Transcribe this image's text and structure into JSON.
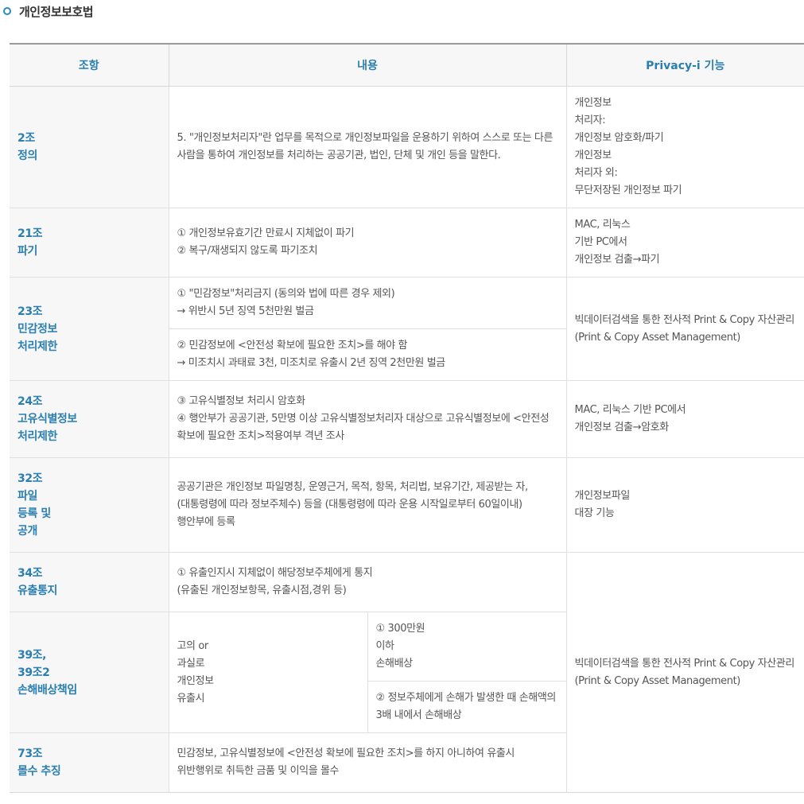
{
  "heading": "개인정보보호법",
  "columns": [
    "조항",
    "내용",
    "Privacy-i 기능"
  ],
  "rows": {
    "r1": {
      "article": "2조\n정의",
      "content": "5. \"개인정보처리자\"란 업무를 목적으로 개인정보파일을 운용하기 위하여 스스로 또는 다른 사람을 통하여 개인정보를 처리하는 공공기관, 법인, 단체 및 개인 등을 말한다.",
      "feature": "개인정보\n처리자:\n개인정보 암호화/파기\n개인정보\n처리자 외:\n무단저장된 개인정보 파기"
    },
    "r2": {
      "article": "21조\n파기",
      "content": "① 개인정보유효기간 만료시 지체없이 파기\n② 복구/재생되지 않도록 파기조치",
      "feature": "MAC, 리눅스\n기반 PC에서\n개인정보 검출→파기"
    },
    "r3": {
      "article": "23조\n민감정보\n처리제한",
      "content_a": "① \"민감정보\"처리금지 (동의와 법에 따른 경우 제외)\n→ 위반시 5년 징역 5천만원 벌금",
      "content_b": "② 민감정보에 <안전성 확보에 필요한 조치>를 해야 함\n→ 미조치시 과태료 3천, 미조치로 유출시 2년 징역 2천만원 벌금",
      "feature": "빅데이터검색을 통한 전사적 Print & Copy 자산관리\n(Print & Copy Asset Management)"
    },
    "r4": {
      "article": "24조\n고유식별정보\n처리제한",
      "content": "③ 고유식별정보 처리시 암호화\n④ 행안부가 공공기관, 5만명 이상 고유식별정보처리자 대상으로 고유식별정보에 <안전성 확보에 필요한 조치>적용여부 격년 조사",
      "feature": "MAC, 리눅스 기반 PC에서\n개인정보 검출→암호화"
    },
    "r5": {
      "article": "32조\n파일\n등록 및\n공개",
      "content": "공공기관은 개인정보 파일명칭, 운영근거, 목적, 항목, 처리법, 보유기간, 제공받는 자, (대통령령에 따라 정보주체수) 등을 (대통령령에 따라 운용 시작일로부터 60일이내) 행안부에 등록",
      "feature": "개인정보파일\n대장 기능"
    },
    "r6": {
      "article": "34조\n유출통지",
      "content": "① 유출인지시 지체없이 해당정보주체에게 통지\n(유출된 개인정보항목, 유출시점,경위 등)"
    },
    "r7": {
      "article": "39조,\n39조2\n손해배상책임",
      "content_left": "고의 or\n과실로\n개인정보\n유출시",
      "content_a": "① 300만원\n이하\n손해배상",
      "content_b": "② 정보주체에게 손해가 발생한 때 손해액의 3배 내에서 손해배상"
    },
    "r8": {
      "article": "73조\n몰수 추징",
      "content": "민감정보, 고유식별정보에 <안전성 확보에 필요한 조치>를 하지 아니하여 유출시 위반행위로 취득한 금품 및 이익을 몰수"
    },
    "shared_feature": "빅데이터검색을 통한 전사적 Print & Copy 자산관리\n(Print & Copy Asset Management)"
  }
}
